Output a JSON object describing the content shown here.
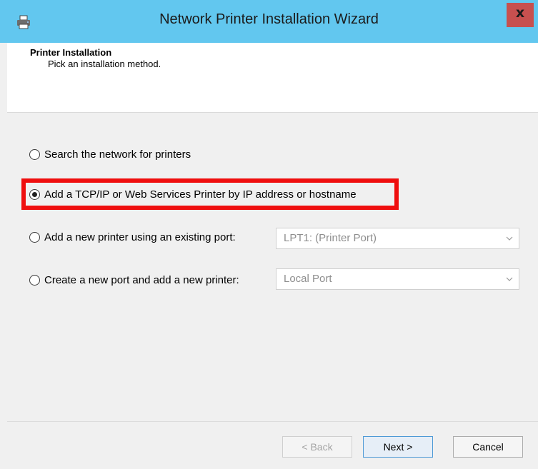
{
  "window": {
    "title": "Network Printer Installation Wizard",
    "close_label": "x",
    "icon": "printer-icon",
    "accent_color": "#62c7ef",
    "close_color": "#c7504f"
  },
  "header": {
    "title": "Printer Installation",
    "subtitle": "Pick an installation method."
  },
  "options": [
    {
      "label": "Search the network for printers",
      "selected": false
    },
    {
      "label": "Add a TCP/IP or Web Services Printer by IP address or hostname",
      "selected": true
    },
    {
      "label": "Add a new printer using an existing port:",
      "selected": false
    },
    {
      "label": "Create a new port and add a new printer:",
      "selected": false
    }
  ],
  "selects": {
    "existing_port": "LPT1: (Printer Port)",
    "new_port": "Local Port"
  },
  "highlight_color": "#ef0e0e",
  "buttons": {
    "back": "< Back",
    "next": "Next >",
    "cancel": "Cancel"
  }
}
